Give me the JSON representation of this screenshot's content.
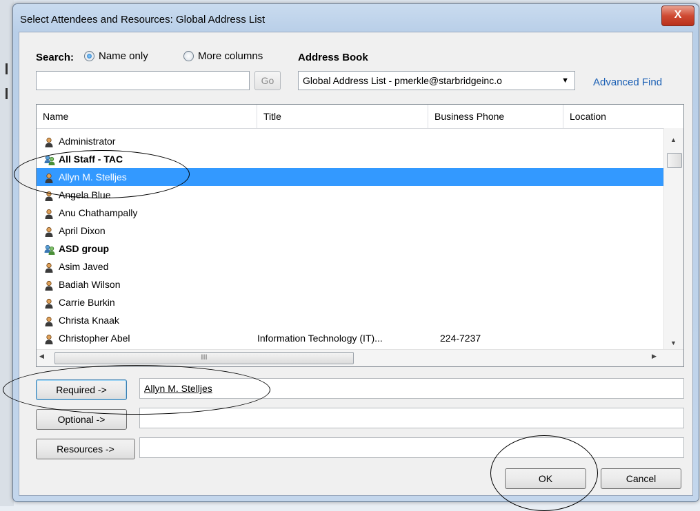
{
  "window": {
    "title": "Select Attendees and Resources: Global Address List",
    "close_label": "X"
  },
  "search": {
    "label": "Search:",
    "options": [
      {
        "label": "Name only",
        "selected": true
      },
      {
        "label": "More columns",
        "selected": false
      }
    ],
    "value": "",
    "go_label": "Go"
  },
  "address_book": {
    "label": "Address Book",
    "selected": "Global Address List - pmerkle@starbridgeinc.o",
    "advanced_find": "Advanced Find"
  },
  "list": {
    "columns": [
      "Name",
      "Title",
      "Business Phone",
      "Location"
    ],
    "rows": [
      {
        "name": "Administrator",
        "title": "",
        "phone": "",
        "type": "user",
        "selected": false
      },
      {
        "name": "All Staff - TAC",
        "title": "",
        "phone": "",
        "type": "group",
        "selected": false
      },
      {
        "name": "Allyn M. Stelljes",
        "title": "",
        "phone": "",
        "type": "user",
        "selected": true
      },
      {
        "name": "Angela Blue",
        "title": "",
        "phone": "",
        "type": "user",
        "selected": false
      },
      {
        "name": "Anu Chathampally",
        "title": "",
        "phone": "",
        "type": "user",
        "selected": false
      },
      {
        "name": "April Dixon",
        "title": "",
        "phone": "",
        "type": "user",
        "selected": false
      },
      {
        "name": "ASD group",
        "title": "",
        "phone": "",
        "type": "group",
        "selected": false
      },
      {
        "name": "Asim Javed",
        "title": "",
        "phone": "",
        "type": "user",
        "selected": false
      },
      {
        "name": "Badiah Wilson",
        "title": "",
        "phone": "",
        "type": "user",
        "selected": false
      },
      {
        "name": "Carrie Burkin",
        "title": "",
        "phone": "",
        "type": "user",
        "selected": false
      },
      {
        "name": "Christa Knaak",
        "title": "",
        "phone": "",
        "type": "user",
        "selected": false
      },
      {
        "name": "Christopher Abel",
        "title": "Information Technology (IT)...",
        "phone": "224-7237",
        "type": "user",
        "selected": false
      }
    ],
    "hscroll_grip": "III"
  },
  "attendees": {
    "required_label": "Required ->",
    "required_value": "Allyn M. Stelljes",
    "optional_label": "Optional ->",
    "optional_value": "",
    "resources_label": "Resources ->",
    "resources_value": ""
  },
  "buttons": {
    "ok": "OK",
    "cancel": "Cancel"
  },
  "colors": {
    "selection": "#3399ff",
    "link": "#1a5fb4",
    "close": "#cf4a33"
  }
}
